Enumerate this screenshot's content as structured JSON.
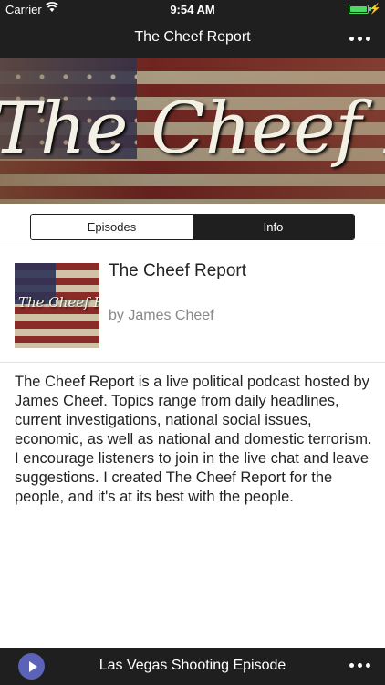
{
  "status_bar": {
    "carrier": "Carrier",
    "time": "9:54 AM",
    "wifi_icon": "wifi-icon",
    "battery_icon": "battery-icon",
    "charging_icon": "charging-bolt-icon"
  },
  "navbar": {
    "title": "The Cheef Report",
    "menu_icon": "more-dots-icon"
  },
  "banner": {
    "text": "The Cheef Report"
  },
  "segments": {
    "episodes_label": "Episodes",
    "info_label": "Info",
    "selected": "Info"
  },
  "podcast": {
    "artwork_text": "The Cheef Report",
    "title": "The Cheef Report",
    "author": "by James Cheef"
  },
  "description": "The Cheef Report is a live political podcast hosted by James Cheef. Topics range from daily headlines, current investigations, national social issues, economic, as well as national and domestic terrorism. I encourage listeners to join in the live chat and leave suggestions. I created The Cheef Report for the people, and it's at its best with the people.",
  "player": {
    "episode_title": "Las Vegas Shooting Episode",
    "play_icon": "play-icon",
    "menu_icon": "more-dots-icon"
  },
  "colors": {
    "bar_background": "#1f1f1f",
    "play_button": "#5a63b8",
    "battery": "#4cd964"
  }
}
